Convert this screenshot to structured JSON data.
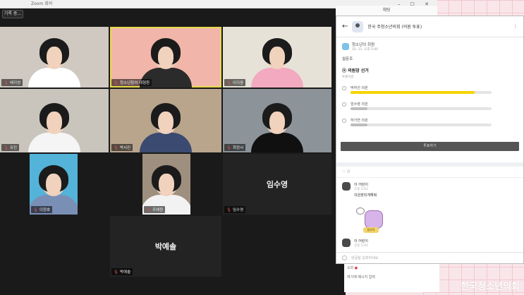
{
  "zoom": {
    "title": "Zoom 회의",
    "view_button": "기록 중...",
    "tiles": [
      {
        "name": "배지영",
        "bg": "#cfc9c2",
        "shirt": "#ffffff"
      },
      {
        "name": "청소년참여 대형환",
        "bg": "#f1b5a9",
        "shirt": "#2b2b2b",
        "active": true
      },
      {
        "name": "이지윤",
        "bg": "#e7e2d7",
        "shirt": "#f3a9c0"
      },
      {
        "name": "유진",
        "bg": "#c9c4bc",
        "shirt": "#f5f5f5"
      },
      {
        "name": "박서진",
        "bg": "#b9a48c",
        "shirt": "#3a4a70"
      },
      {
        "name": "최정서",
        "bg": "#8c949a",
        "shirt": "#101010"
      },
      {
        "name": "이정호",
        "bg": "#53b3d9",
        "shirt": "#7a8fb5"
      },
      {
        "name": "주예원",
        "bg": "#9e8f7e",
        "shirt": "#f2f2f2"
      },
      {
        "name": "임수영",
        "big": "임수영"
      },
      {
        "name": "박예솔",
        "big": "박예솔"
      }
    ]
  },
  "kakao": {
    "window_title": "채팅",
    "room_name": "한국 주청소년의회 (의원 투표)",
    "post_author": "청소년의 회원",
    "post_time": "10. 11. 오후 5:00",
    "post_body": "설문조",
    "poll_title": "의원장 선거",
    "poll_sub": "투표마감",
    "options": [
      {
        "label": "박하선 의원",
        "fraction": 0.88,
        "color": "#f5d400"
      },
      {
        "label": "임수영 의원",
        "fraction": 0.12,
        "color": "#bdbdbd"
      },
      {
        "label": "하가연 의원",
        "fraction": 0.12,
        "color": "#bdbdbd"
      }
    ],
    "vote_button": "투표하기",
    "react_count": "0",
    "comments": [
      {
        "author": "이 어린이",
        "time": "오후 5:01",
        "text": "의원장되게해줘"
      },
      {
        "author": "이 어린이",
        "time": "오후 5:01",
        "text": ""
      }
    ],
    "sticker_text": "잘부탁",
    "input_placeholder": "댓글을 입력하세요"
  },
  "below": {
    "line1": "소리",
    "line2": "여기에 메시지 입력"
  },
  "watermark": "한국청소년의회"
}
